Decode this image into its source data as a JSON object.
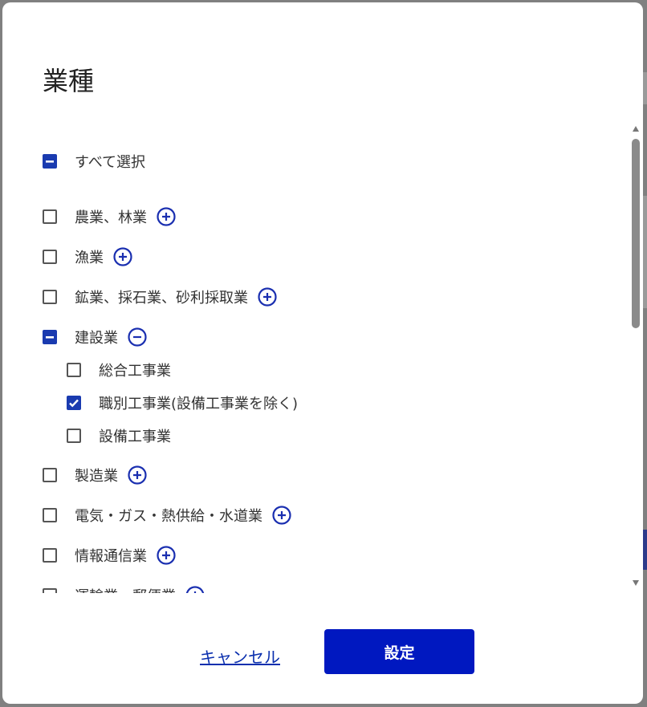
{
  "dialog": {
    "title": "業種",
    "select_all": {
      "label": "すべて選択",
      "state": "indeterminate"
    },
    "categories": [
      {
        "label": "農業、林業",
        "state": "unchecked",
        "expander": "plus"
      },
      {
        "label": "漁業",
        "state": "unchecked",
        "expander": "plus"
      },
      {
        "label": "鉱業、採石業、砂利採取業",
        "state": "unchecked",
        "expander": "plus"
      },
      {
        "label": "建設業",
        "state": "indeterminate",
        "expander": "minus",
        "children": [
          {
            "label": "総合工事業",
            "state": "unchecked"
          },
          {
            "label": "職別工事業(設備工事業を除く)",
            "state": "checked"
          },
          {
            "label": "設備工事業",
            "state": "unchecked"
          }
        ]
      },
      {
        "label": "製造業",
        "state": "unchecked",
        "expander": "plus"
      },
      {
        "label": "電気・ガス・熱供給・水道業",
        "state": "unchecked",
        "expander": "plus"
      },
      {
        "label": "情報通信業",
        "state": "unchecked",
        "expander": "plus"
      },
      {
        "label": "運輸業、郵便業",
        "state": "unchecked",
        "expander": "plus"
      }
    ],
    "cancel_label": "キャンセル",
    "submit_label": "設定"
  },
  "colors": {
    "accent": "#1a3bb0",
    "primary_button": "#0018c0",
    "link": "#0a2fae",
    "overlay": "#808080"
  },
  "icons": {
    "expand": "plus-circle-icon",
    "collapse": "minus-circle-icon",
    "checked": "checkmark-icon",
    "indeterminate": "dash-icon"
  }
}
